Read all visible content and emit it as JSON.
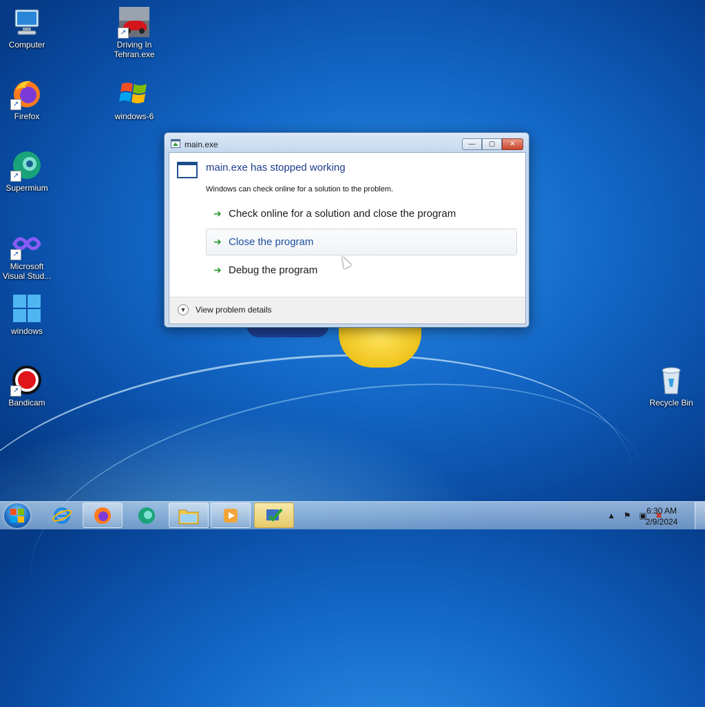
{
  "desktop": {
    "icons": [
      {
        "label": "Computer"
      },
      {
        "label": "Driving In Tehran.exe"
      },
      {
        "label": "Firefox"
      },
      {
        "label": "windows-6"
      },
      {
        "label": "Supermium"
      },
      {
        "label": "Microsoft Visual Stud..."
      },
      {
        "label": "windows"
      },
      {
        "label": "Bandicam"
      },
      {
        "label": "Recycle Bin"
      }
    ]
  },
  "dialog": {
    "title": "main.exe",
    "headline": "main.exe has stopped working",
    "message": "Windows can check online for a solution to the problem.",
    "options": [
      {
        "label": "Check online for a solution and close the program"
      },
      {
        "label": "Close the program"
      },
      {
        "label": "Debug the program"
      }
    ],
    "details_label": "View problem details",
    "buttons": {
      "minimize": "—",
      "maximize": "▢",
      "close": "✕"
    }
  },
  "taskbar": {
    "clock_time": "6:30 AM",
    "clock_date": "2/9/2024",
    "tray_up": "▲",
    "tray_flag": "⚑",
    "tray_network": "▣",
    "tray_volume": "✖"
  },
  "colors": {
    "accent": "#1e3a8c",
    "arrow": "#2e9a36",
    "close": "#c8452b"
  }
}
